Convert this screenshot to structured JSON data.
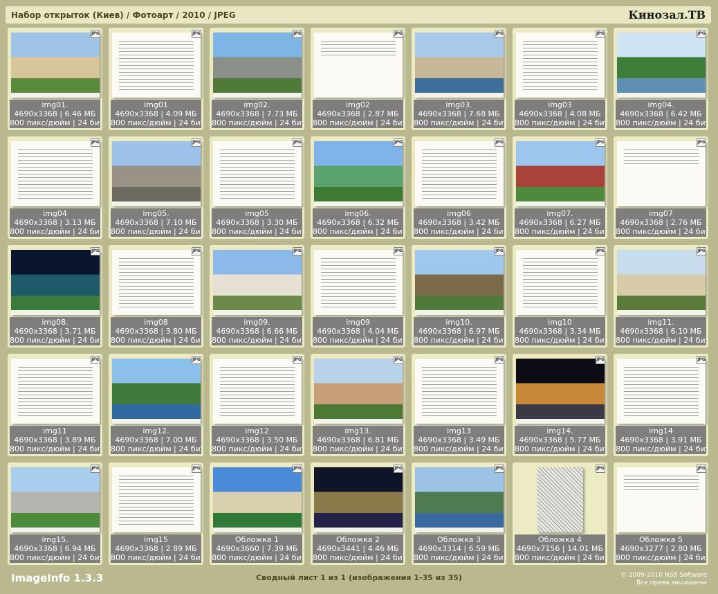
{
  "header": {
    "title": "Набор открыток (Киев) / Фотоарт / 2010 / JPEG",
    "brand": "Кинозал.ТВ"
  },
  "badge_label": "JPG",
  "colors": {
    "background": "#b9b88e",
    "cell": "#ecebc4",
    "info_panel": "#7f7e7d",
    "header_bg": "#e9e7c4"
  },
  "items": [
    {
      "name": "img01.",
      "dims": "4690x3368 | 6.46 МБ",
      "meta": "800 пикс/дюйм | 24 бит",
      "kind": "photo",
      "colors": [
        "#9ec4e8",
        "#d9c59a",
        "#5a8a3c"
      ]
    },
    {
      "name": "img01",
      "dims": "4690x3368 | 4.09 МБ",
      "meta": "800 пикс/дюйм | 24 бит",
      "kind": "text"
    },
    {
      "name": "img02.",
      "dims": "4690x3368 | 7.73 МБ",
      "meta": "800 пикс/дюйм | 24 бит",
      "kind": "photo",
      "colors": [
        "#7fb4e6",
        "#8a8f8a",
        "#4f7a3a"
      ]
    },
    {
      "name": "img02",
      "dims": "4690x3368 | 2.87 МБ",
      "meta": "800 пикс/дюйм | 24 бит",
      "kind": "text-sparse"
    },
    {
      "name": "img03.",
      "dims": "4690x3368 | 7.68 МБ",
      "meta": "800 пикс/дюйм | 24 бит",
      "kind": "photo",
      "colors": [
        "#a9c9ea",
        "#c8b89a",
        "#3d6f9c"
      ]
    },
    {
      "name": "img03",
      "dims": "4690x3368 | 4.08 МБ",
      "meta": "800 пикс/дюйм | 24 бит",
      "kind": "text"
    },
    {
      "name": "img04.",
      "dims": "4690x3368 | 6.42 МБ",
      "meta": "800 пикс/дюйм | 24 бит",
      "kind": "photo",
      "colors": [
        "#cfe3f4",
        "#3f7d3a",
        "#5e8fb0"
      ]
    },
    {
      "name": "img04",
      "dims": "4690x3368 | 3.13 МБ",
      "meta": "800 пикс/дюйм | 24 бит",
      "kind": "text"
    },
    {
      "name": "img05.",
      "dims": "4690x3368 | 7.10 МБ",
      "meta": "800 пикс/дюйм | 24 бит",
      "kind": "photo",
      "colors": [
        "#9cc2ea",
        "#9a9284",
        "#6c6a60"
      ]
    },
    {
      "name": "img05",
      "dims": "4690x3368 | 3.30 МБ",
      "meta": "800 пикс/дюйм | 24 бит",
      "kind": "text"
    },
    {
      "name": "img06.",
      "dims": "4690x3368 | 6.32 МБ",
      "meta": "800 пикс/дюйм | 24 бит",
      "kind": "photo",
      "colors": [
        "#7fb3ea",
        "#5aa36e",
        "#3f7a33"
      ]
    },
    {
      "name": "img06",
      "dims": "4690x3368 | 3.42 МБ",
      "meta": "800 пикс/дюйм | 24 бит",
      "kind": "text"
    },
    {
      "name": "img07.",
      "dims": "4690x3368 | 6.27 МБ",
      "meta": "800 пикс/дюйм | 24 бит",
      "kind": "photo",
      "colors": [
        "#9cc6ee",
        "#a8423a",
        "#4f8a3c"
      ]
    },
    {
      "name": "img07",
      "dims": "4690x3368 | 2.76 МБ",
      "meta": "800 пикс/дюйм | 24 бит",
      "kind": "text-sparse"
    },
    {
      "name": "img08.",
      "dims": "4690x3368 | 3.71 МБ",
      "meta": "800 пикс/дюйм | 24 бит",
      "kind": "photo",
      "colors": [
        "#0a1530",
        "#1e5a6a",
        "#3a7a3a"
      ]
    },
    {
      "name": "img08",
      "dims": "4690x3368 | 3.80 МБ",
      "meta": "800 пикс/дюйм | 24 бит",
      "kind": "text"
    },
    {
      "name": "img09.",
      "dims": "4690x3368 | 6.66 МБ",
      "meta": "800 пикс/дюйм | 24 бит",
      "kind": "photo",
      "colors": [
        "#8ab9ea",
        "#e6e1d2",
        "#6a8a4a"
      ]
    },
    {
      "name": "img09",
      "dims": "4690x3368 | 4.04 МБ",
      "meta": "800 пикс/дюйм | 24 бит",
      "kind": "text"
    },
    {
      "name": "img10.",
      "dims": "4690x3368 | 6.97 МБ",
      "meta": "800 пикс/дюйм | 24 бит",
      "kind": "photo",
      "colors": [
        "#9fc8ee",
        "#7a6a4a",
        "#4f7a3c"
      ]
    },
    {
      "name": "img10",
      "dims": "4690x3368 | 3.34 МБ",
      "meta": "800 пикс/дюйм | 24 бит",
      "kind": "text"
    },
    {
      "name": "img11.",
      "dims": "4690x3368 | 6.10 МБ",
      "meta": "800 пикс/дюйм | 24 бит",
      "kind": "photo",
      "colors": [
        "#c9dcee",
        "#d8cba8",
        "#5a7a3a"
      ]
    },
    {
      "name": "img11",
      "dims": "4690x3368 | 3.89 МБ",
      "meta": "800 пикс/дюйм | 24 бит",
      "kind": "text"
    },
    {
      "name": "img12.",
      "dims": "4690x3368 | 7.00 МБ",
      "meta": "800 пикс/дюйм | 24 бит",
      "kind": "photo",
      "colors": [
        "#8cc0ea",
        "#3f7a3a",
        "#2f6aa0"
      ]
    },
    {
      "name": "img12",
      "dims": "4690x3368 | 3.50 МБ",
      "meta": "800 пикс/дюйм | 24 бит",
      "kind": "text"
    },
    {
      "name": "img13.",
      "dims": "4690x3368 | 6.81 МБ",
      "meta": "800 пикс/дюйм | 24 бит",
      "kind": "photo",
      "colors": [
        "#b7d2ea",
        "#c7a079",
        "#4c7a34"
      ]
    },
    {
      "name": "img13",
      "dims": "4690x3368 | 3.49 МБ",
      "meta": "800 пикс/дюйм | 24 бит",
      "kind": "text"
    },
    {
      "name": "img14.",
      "dims": "4690x3368 | 5.77 МБ",
      "meta": "800 пикс/дюйм | 24 бит",
      "kind": "photo",
      "colors": [
        "#0c0c14",
        "#c88a3a",
        "#3a3a46"
      ]
    },
    {
      "name": "img14",
      "dims": "4690x3368 | 3.91 МБ",
      "meta": "800 пикс/дюйм | 24 бит",
      "kind": "text"
    },
    {
      "name": "img15.",
      "dims": "4690x3368 | 6.94 МБ",
      "meta": "800 пикс/дюйм | 24 бит",
      "kind": "photo",
      "colors": [
        "#a8cdee",
        "#b5b5b0",
        "#4c8a3c"
      ]
    },
    {
      "name": "img15",
      "dims": "4690x3368 | 2.89 МБ",
      "meta": "800 пикс/дюйм | 24 бит",
      "kind": "text"
    },
    {
      "name": "Обложка 1",
      "dims": "4690x3660 | 7.39 МБ",
      "meta": "800 пикс/дюйм | 24 бит",
      "kind": "photo",
      "colors": [
        "#4a8ad8",
        "#d9d0b0",
        "#2f7a34"
      ]
    },
    {
      "name": "Обложка 2",
      "dims": "4690x3441 | 4.46 МБ",
      "meta": "800 пикс/дюйм | 24 бит",
      "kind": "photo",
      "colors": [
        "#0f1428",
        "#8a7a4a",
        "#23234a"
      ]
    },
    {
      "name": "Обложка 3",
      "dims": "4690x3314 | 6.59 МБ",
      "meta": "800 пикс/дюйм | 24 бит",
      "kind": "photo",
      "colors": [
        "#9cc2e6",
        "#4f7a52",
        "#3a6aa0"
      ]
    },
    {
      "name": "Обложка 4",
      "dims": "4690x7156 | 14.01 МБ",
      "meta": "800 пикс/дюйм | 24 бит",
      "kind": "map"
    },
    {
      "name": "Обложка 5",
      "dims": "4690x3277 | 2.80 МБ",
      "meta": "800 пикс/дюйм | 24 бит",
      "kind": "text-sparse"
    }
  ],
  "footer": {
    "app": "ImageInfo 1.3.3",
    "summary": "Сводный лист 1 из 1 (изображения 1-35 из 35)",
    "copyright": "© 2009-2010 NSB Software",
    "rights": "Все права защищены"
  }
}
